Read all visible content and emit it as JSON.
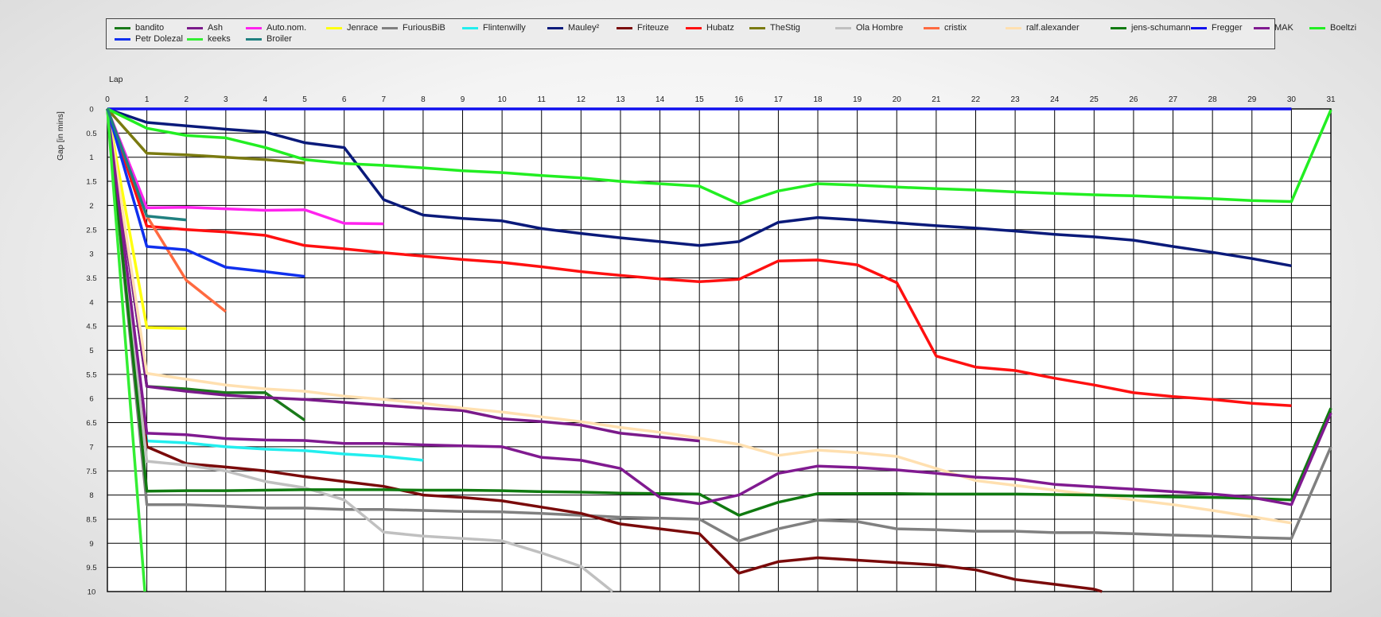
{
  "chart_data": {
    "type": "line",
    "xlabel": "Lap",
    "ylabel": "Gap [in mins]",
    "xlim": [
      0,
      31
    ],
    "ylim": [
      0,
      10
    ],
    "y_inverted": true,
    "x_ticks": [
      0,
      1,
      2,
      3,
      4,
      5,
      6,
      7,
      8,
      9,
      10,
      11,
      12,
      13,
      14,
      15,
      16,
      17,
      18,
      19,
      20,
      21,
      22,
      23,
      24,
      25,
      26,
      27,
      28,
      29,
      30,
      31
    ],
    "y_ticks": [
      0,
      0.5,
      1,
      1.5,
      2,
      2.5,
      3,
      3.5,
      4,
      4.5,
      5,
      5.5,
      6,
      6.5,
      7,
      7.5,
      8,
      8.5,
      9,
      9.5,
      10
    ],
    "y_tick_labels": [
      "0",
      "0.5",
      "1",
      "1.5",
      "2",
      "2.5",
      "3",
      "3.5",
      "4",
      "4.5",
      "5",
      "5.5",
      "6",
      "6.5",
      "7",
      "7.5",
      "8",
      "8.5",
      "9",
      "9.5",
      "10"
    ],
    "grid": true,
    "legend_position": "top",
    "series": [
      {
        "name": "bandito",
        "color": "#1a7a1a",
        "x": [
          0,
          1,
          2,
          3,
          4,
          5
        ],
        "y": [
          0,
          5.75,
          5.8,
          5.88,
          5.88,
          6.45
        ]
      },
      {
        "name": "Ash",
        "color": "#7a1a8a",
        "x": [
          0,
          1,
          2,
          3,
          4,
          5,
          6,
          7,
          8,
          9,
          10,
          11,
          12,
          13,
          14,
          15,
          16,
          17,
          18,
          19,
          20,
          21,
          22,
          23,
          24,
          25,
          26,
          27,
          28,
          29,
          30,
          31
        ],
        "y": [
          0,
          5.75,
          5.85,
          5.93,
          5.98,
          6.02,
          6.08,
          6.14,
          6.2,
          6.25,
          6.42,
          6.48,
          6.55,
          6.72,
          6.8,
          6.88,
          null,
          null,
          null,
          null,
          null,
          null,
          null,
          null,
          null,
          null,
          null,
          null,
          null,
          null,
          null,
          null
        ]
      },
      {
        "name": "Auto.nom.",
        "color": "#ff22ee",
        "x": [
          0,
          1,
          2,
          3,
          4,
          5,
          6,
          7
        ],
        "y": [
          0,
          2.05,
          2.04,
          2.07,
          2.1,
          2.09,
          2.37,
          2.38
        ]
      },
      {
        "name": "Jenrace",
        "color": "#ffff10",
        "x": [
          0,
          1,
          2
        ],
        "y": [
          0,
          4.53,
          4.55
        ]
      },
      {
        "name": "FuriousBiB",
        "color": "#808080",
        "x": [
          0,
          1,
          2,
          3,
          4,
          5,
          6,
          7,
          8,
          9,
          10,
          11,
          12,
          13,
          14,
          15,
          16,
          17,
          18,
          19,
          20,
          21,
          22,
          23,
          24,
          25,
          26,
          27,
          28,
          29,
          30,
          31
        ],
        "y": [
          0,
          8.2,
          8.2,
          8.23,
          8.27,
          8.27,
          8.3,
          8.3,
          8.32,
          8.34,
          8.35,
          8.38,
          8.42,
          8.46,
          8.48,
          8.5,
          8.95,
          8.7,
          8.52,
          8.55,
          8.7,
          8.72,
          8.75,
          8.75,
          8.78,
          8.78,
          8.8,
          8.83,
          8.85,
          8.88,
          8.9,
          7.0
        ]
      },
      {
        "name": "Flintenwilly",
        "color": "#22eeee",
        "x": [
          0,
          1,
          2,
          3,
          4,
          5,
          6,
          7,
          8
        ],
        "y": [
          0,
          6.88,
          6.92,
          7.0,
          7.05,
          7.08,
          7.15,
          7.2,
          7.28
        ]
      },
      {
        "name": "Mauley²",
        "color": "#0a1a7a",
        "x": [
          0,
          1,
          2,
          3,
          4,
          5,
          6,
          7,
          8,
          9,
          10,
          11,
          12,
          13,
          14,
          15,
          16,
          17,
          18,
          19,
          20,
          21,
          22,
          23,
          24,
          25,
          26,
          27,
          28,
          29,
          30
        ],
        "y": [
          0,
          0.28,
          0.35,
          0.42,
          0.48,
          0.7,
          0.8,
          1.88,
          2.2,
          2.27,
          2.32,
          2.48,
          2.58,
          2.67,
          2.75,
          2.83,
          2.75,
          2.35,
          2.25,
          2.3,
          2.36,
          2.42,
          2.47,
          2.53,
          2.6,
          2.65,
          2.72,
          2.85,
          2.97,
          3.1,
          3.25
        ]
      },
      {
        "name": "Friteuze",
        "color": "#7a0a0a",
        "x": [
          0,
          1,
          2,
          3,
          4,
          5,
          6,
          7,
          8,
          9,
          10,
          11,
          12,
          13,
          14,
          15,
          16,
          17,
          18,
          19,
          20,
          21,
          22,
          23,
          24,
          25,
          25.2
        ],
        "y": [
          0,
          7.0,
          7.35,
          7.42,
          7.5,
          7.62,
          7.72,
          7.82,
          8.0,
          8.05,
          8.12,
          8.25,
          8.38,
          8.6,
          8.7,
          8.8,
          9.62,
          9.38,
          9.3,
          9.35,
          9.4,
          9.45,
          9.55,
          9.75,
          9.85,
          9.95,
          10.0
        ]
      },
      {
        "name": "Hubatz",
        "color": "#ff1010",
        "x": [
          0,
          1,
          2,
          3,
          4,
          5,
          6,
          7,
          8,
          9,
          10,
          11,
          12,
          13,
          14,
          15,
          16,
          17,
          18,
          19,
          20,
          21,
          22,
          23,
          24,
          25,
          26,
          27,
          28,
          29,
          30
        ],
        "y": [
          0,
          2.43,
          2.5,
          2.55,
          2.62,
          2.83,
          2.9,
          2.98,
          3.05,
          3.12,
          3.18,
          3.27,
          3.37,
          3.45,
          3.52,
          3.58,
          3.53,
          3.15,
          3.13,
          3.23,
          3.6,
          5.12,
          5.35,
          5.42,
          5.58,
          5.72,
          5.88,
          5.96,
          6.02,
          6.1,
          6.15
        ]
      },
      {
        "name": "TheStig",
        "color": "#7a7a10",
        "x": [
          0,
          1,
          2,
          3,
          4,
          5
        ],
        "y": [
          0,
          0.92,
          0.95,
          1.0,
          1.05,
          1.12
        ]
      },
      {
        "name": "Ola Hombre",
        "color": "#c0c0c0",
        "x": [
          0,
          1,
          2,
          3,
          4,
          5,
          6,
          7,
          8,
          9,
          10,
          11,
          12,
          12.8
        ],
        "y": [
          0,
          7.3,
          7.38,
          7.5,
          7.72,
          7.85,
          8.1,
          8.77,
          8.85,
          8.9,
          8.95,
          9.2,
          9.48,
          10.0
        ]
      },
      {
        "name": "cristix",
        "color": "#ff6a40",
        "x": [
          0,
          1,
          2,
          3
        ],
        "y": [
          0,
          2.22,
          3.55,
          4.2
        ]
      },
      {
        "name": "ralf.alexander",
        "color": "#ffe0b0",
        "x": [
          0,
          1,
          2,
          3,
          4,
          5,
          6,
          7,
          8,
          9,
          10,
          11,
          12,
          13,
          14,
          15,
          16,
          17,
          18,
          19,
          20,
          21,
          22,
          23,
          24,
          25,
          26,
          27,
          28,
          29,
          30
        ],
        "y": [
          0,
          5.48,
          5.6,
          5.72,
          5.8,
          5.85,
          5.95,
          6.02,
          6.1,
          6.2,
          6.28,
          6.38,
          6.48,
          6.6,
          6.7,
          6.82,
          6.95,
          7.18,
          7.07,
          7.12,
          7.2,
          7.45,
          7.7,
          7.8,
          7.9,
          8.0,
          8.1,
          8.2,
          8.32,
          8.45,
          8.58
        ]
      },
      {
        "name": "jens-schumann",
        "color": "#107a10",
        "x": [
          0,
          1,
          2,
          3,
          4,
          5,
          6,
          7,
          8,
          9,
          10,
          11,
          12,
          13,
          14,
          15,
          16,
          17,
          18,
          19,
          20,
          21,
          22,
          23,
          24,
          25,
          26,
          27,
          28,
          29,
          30,
          31
        ],
        "y": [
          0,
          7.92,
          7.91,
          7.91,
          7.9,
          7.89,
          7.89,
          7.89,
          7.9,
          7.9,
          7.91,
          7.93,
          7.94,
          7.96,
          7.97,
          7.98,
          8.42,
          8.15,
          7.97,
          7.97,
          7.97,
          7.98,
          7.98,
          7.98,
          7.99,
          8.0,
          8.02,
          8.04,
          8.05,
          8.07,
          8.1,
          6.2
        ]
      },
      {
        "name": "Fregger",
        "color": "#1010ee",
        "x": [
          0,
          1,
          2,
          3,
          4,
          5,
          6,
          7,
          8,
          9,
          10,
          11,
          12,
          13,
          14,
          15,
          16,
          17,
          18,
          19,
          20,
          21,
          22,
          23,
          24,
          25,
          26,
          27,
          28,
          29,
          30
        ],
        "y": [
          0,
          0,
          0,
          0,
          0,
          0,
          0,
          0,
          0,
          0,
          0,
          0,
          0,
          0,
          0,
          0,
          0,
          0,
          0,
          0,
          0,
          0,
          0,
          0,
          0,
          0,
          0,
          0,
          0,
          0,
          0
        ]
      },
      {
        "name": "MAK",
        "color": "#801a90",
        "x": [
          0,
          1,
          2,
          3,
          4,
          5,
          6,
          7,
          8,
          9,
          10,
          11,
          12,
          13,
          14,
          15,
          16,
          17,
          18,
          19,
          20,
          21,
          22,
          23,
          24,
          25,
          26,
          27,
          28,
          29,
          30,
          31
        ],
        "y": [
          0,
          6.72,
          6.75,
          6.83,
          6.86,
          6.87,
          6.93,
          6.93,
          6.96,
          6.98,
          7.0,
          7.22,
          7.28,
          7.45,
          8.05,
          8.18,
          8.0,
          7.55,
          7.4,
          7.43,
          7.48,
          7.55,
          7.63,
          7.67,
          7.78,
          7.83,
          7.88,
          7.93,
          7.98,
          8.05,
          8.2,
          6.3
        ]
      },
      {
        "name": "Boeltzi",
        "color": "#22ee22",
        "x": [
          0,
          1,
          2,
          3,
          4,
          5,
          6,
          7,
          8,
          9,
          10,
          11,
          12,
          13,
          14,
          15,
          16,
          17,
          18,
          19,
          20,
          21,
          22,
          23,
          24,
          25,
          26,
          27,
          28,
          29,
          30,
          31
        ],
        "y": [
          0,
          0.4,
          0.55,
          0.6,
          0.8,
          1.05,
          1.13,
          1.17,
          1.22,
          1.28,
          1.32,
          1.38,
          1.43,
          1.5,
          1.55,
          1.6,
          1.97,
          1.7,
          1.55,
          1.58,
          1.62,
          1.65,
          1.68,
          1.72,
          1.75,
          1.78,
          1.8,
          1.83,
          1.86,
          1.9,
          1.92,
          0.02
        ]
      },
      {
        "name": "Petr Dolezal",
        "color": "#1030ee",
        "x": [
          0,
          1,
          2,
          3,
          4,
          5
        ],
        "y": [
          0,
          2.85,
          2.92,
          3.28,
          3.37,
          3.47
        ]
      },
      {
        "name": "keeks",
        "color": "#33ee33",
        "x": [
          0,
          0.95
        ],
        "y": [
          0,
          10.0
        ]
      },
      {
        "name": "Broiler",
        "color": "#208080",
        "x": [
          0,
          1,
          2
        ],
        "y": [
          0,
          2.22,
          2.3
        ]
      }
    ]
  },
  "legend_rows": [
    [
      0,
      1,
      2,
      3,
      4,
      5,
      6,
      7,
      8,
      9,
      10,
      11,
      12,
      13,
      14,
      15,
      16
    ],
    [
      17,
      18,
      19
    ]
  ]
}
